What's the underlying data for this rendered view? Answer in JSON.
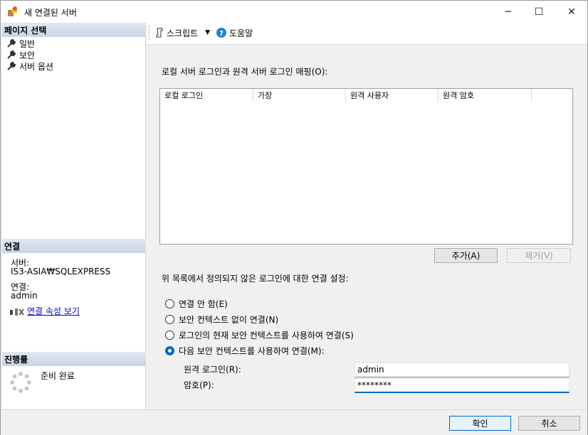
{
  "window": {
    "title": "새 연결된 서버",
    "minimize": "─",
    "maximize": "☐",
    "close": "✕"
  },
  "left_panel": {
    "select_page_title": "페이지 선택",
    "pages": [
      {
        "label": "일반",
        "icon": "wrench-icon"
      },
      {
        "label": "보안",
        "icon": "wrench-icon"
      },
      {
        "label": "서버 옵션",
        "icon": "wrench-icon"
      }
    ],
    "connection_title": "연결",
    "server_label": "서버:",
    "server_value": "IS3-ASIA₩SQLEXPRESS",
    "connection_label": "연결:",
    "connection_value": "admin",
    "view_props_link": "연결 속성 보기",
    "progress_title": "진행률",
    "progress_status": "준비 완료"
  },
  "toolbar": {
    "script_label": "스크립트",
    "help_label": "도움말"
  },
  "main": {
    "mapping_label": "로컬 서버 로그인과 원격 서버 로그인 매핑(O):",
    "grid_columns": [
      "로컬 로그인",
      "가장",
      "원격 사용자",
      "원격 암호"
    ],
    "add_button": "추가(A)",
    "remove_button": "제거(V)",
    "undefined_label": "위 목록에서 정의되지 않은 로그인에 대한 연결 설정:",
    "options": [
      {
        "label": "연결 안 함(E)",
        "selected": false
      },
      {
        "label": "보안 컨텍스트 없이 연결(N)",
        "selected": false
      },
      {
        "label": "로그인의 현재 보안 컨텍스트를 사용하여 연결(S)",
        "selected": false
      },
      {
        "label": "다음 보안 컨텍스트를 사용하여 연결(M):",
        "selected": true
      }
    ],
    "remote_login_label": "원격 로그인(R):",
    "remote_login_value": "admin",
    "password_label": "암호(P):",
    "password_value": "********"
  },
  "footer": {
    "ok_button": "확인",
    "cancel_button": "취소"
  },
  "colors": {
    "accent": "#0067c0",
    "link": "#0000cc",
    "section_header": "#c9d6e6"
  }
}
